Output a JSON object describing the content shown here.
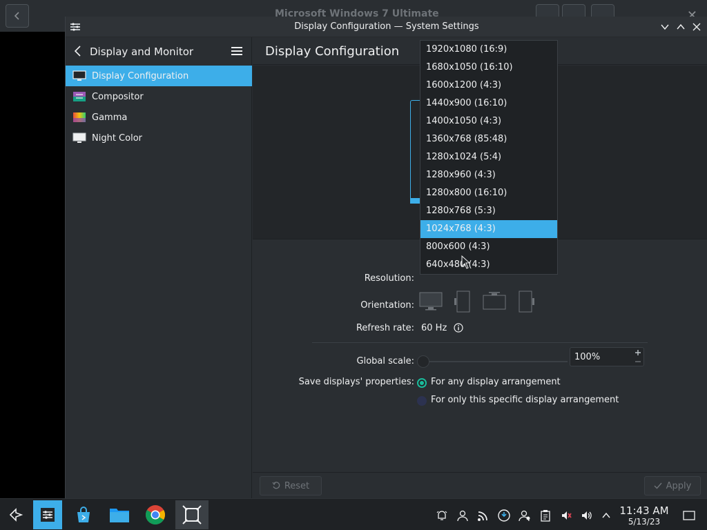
{
  "background_app": {
    "title": "Microsoft Windows 7 Ultimate"
  },
  "window": {
    "title": "Display Configuration — System Settings"
  },
  "sidebar": {
    "title": "Display and Monitor",
    "items": [
      {
        "label": "Display Configuration",
        "icon": "monitor-icon",
        "active": true
      },
      {
        "label": "Compositor",
        "icon": "compositor-icon"
      },
      {
        "label": "Gamma",
        "icon": "gamma-icon"
      },
      {
        "label": "Night Color",
        "icon": "night-color-icon"
      }
    ]
  },
  "content": {
    "title": "Display Configuration",
    "resolution_label": "Resolution:",
    "orientation_label": "Orientation:",
    "refresh_rate_label": "Refresh rate:",
    "refresh_rate_value": "60 Hz",
    "global_scale_label": "Global scale:",
    "global_scale_value": "100%",
    "save_label": "Save displays' properties:",
    "save_options": [
      {
        "label": "For any display arrangement",
        "selected": true
      },
      {
        "label": "For only this specific display arrangement",
        "selected": false
      }
    ],
    "reset_label": "Reset",
    "apply_label": "Apply"
  },
  "resolution_dropdown": {
    "options": [
      "1920x1080 (16:9)",
      "1680x1050 (16:10)",
      "1600x1200 (4:3)",
      "1440x900 (16:10)",
      "1400x1050 (4:3)",
      "1360x768 (85:48)",
      "1280x1024 (5:4)",
      "1280x960 (4:3)",
      "1280x800 (16:10)",
      "1280x768 (5:3)",
      "1024x768 (4:3)",
      "800x600 (4:3)",
      "640x480 (4:3)"
    ],
    "selected": "1024x768 (4:3)"
  },
  "taskbar": {
    "clock_time": "11:43 AM",
    "clock_date": "5/13/23"
  },
  "colors": {
    "accent": "#3daee9",
    "radio": "#1abc9c",
    "window_bg": "#2a2e32",
    "panel_bg": "#232629"
  }
}
